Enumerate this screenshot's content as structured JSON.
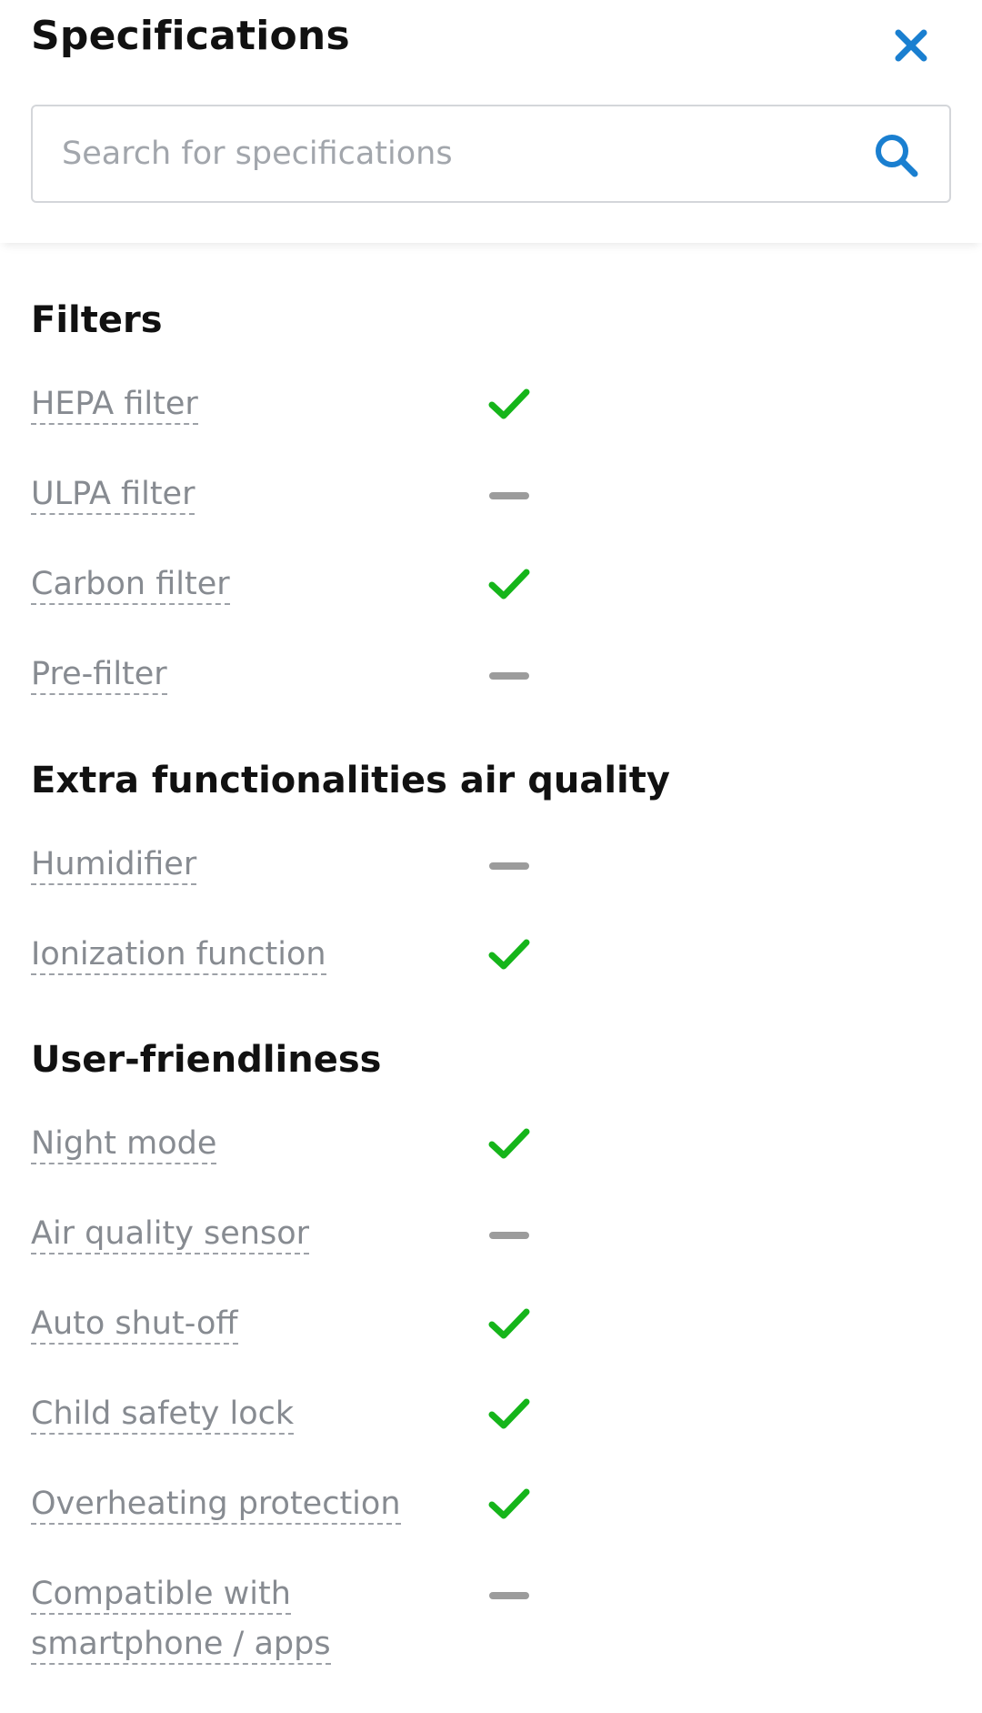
{
  "header": {
    "title": "Specifications",
    "close_icon": "close-icon",
    "search": {
      "placeholder": "Search for specifications",
      "value": "",
      "icon": "search-icon"
    }
  },
  "colors": {
    "accent": "#1a7fd0",
    "check": "#15b51a",
    "dash": "#9c9c9c",
    "label": "#878b91"
  },
  "sections": [
    {
      "title": "Filters",
      "items": [
        {
          "label": "HEPA filter",
          "status": "yes"
        },
        {
          "label": "ULPA filter",
          "status": "no"
        },
        {
          "label": "Carbon filter",
          "status": "yes"
        },
        {
          "label": "Pre-filter",
          "status": "no"
        }
      ]
    },
    {
      "title": "Extra functionalities air quality",
      "items": [
        {
          "label": "Humidifier",
          "status": "no"
        },
        {
          "label": "Ionization function",
          "status": "yes"
        }
      ]
    },
    {
      "title": "User-friendliness",
      "items": [
        {
          "label": "Night mode",
          "status": "yes"
        },
        {
          "label": "Air quality sensor",
          "status": "no"
        },
        {
          "label": "Auto shut-off",
          "status": "yes"
        },
        {
          "label": "Child safety lock",
          "status": "yes"
        },
        {
          "label": "Overheating protection",
          "status": "yes"
        },
        {
          "label_line1": "Compatible with",
          "label_line2": "smartphone / apps",
          "status": "no"
        }
      ]
    }
  ]
}
